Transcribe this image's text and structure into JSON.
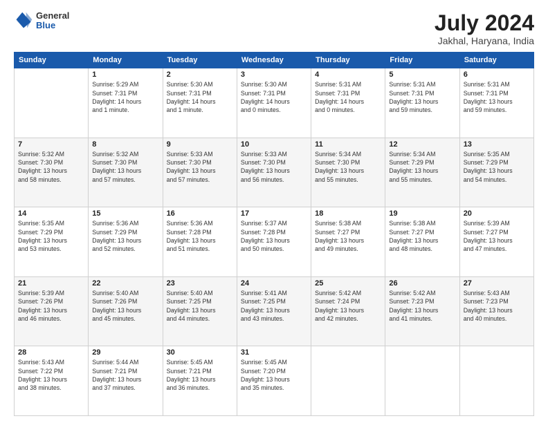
{
  "logo": {
    "general": "General",
    "blue": "Blue"
  },
  "title": "July 2024",
  "subtitle": "Jakhal, Haryana, India",
  "columns": [
    "Sunday",
    "Monday",
    "Tuesday",
    "Wednesday",
    "Thursday",
    "Friday",
    "Saturday"
  ],
  "weeks": [
    [
      {
        "day": "",
        "info": ""
      },
      {
        "day": "1",
        "info": "Sunrise: 5:29 AM\nSunset: 7:31 PM\nDaylight: 14 hours\nand 1 minute."
      },
      {
        "day": "2",
        "info": "Sunrise: 5:30 AM\nSunset: 7:31 PM\nDaylight: 14 hours\nand 1 minute."
      },
      {
        "day": "3",
        "info": "Sunrise: 5:30 AM\nSunset: 7:31 PM\nDaylight: 14 hours\nand 0 minutes."
      },
      {
        "day": "4",
        "info": "Sunrise: 5:31 AM\nSunset: 7:31 PM\nDaylight: 14 hours\nand 0 minutes."
      },
      {
        "day": "5",
        "info": "Sunrise: 5:31 AM\nSunset: 7:31 PM\nDaylight: 13 hours\nand 59 minutes."
      },
      {
        "day": "6",
        "info": "Sunrise: 5:31 AM\nSunset: 7:31 PM\nDaylight: 13 hours\nand 59 minutes."
      }
    ],
    [
      {
        "day": "7",
        "info": "Sunrise: 5:32 AM\nSunset: 7:30 PM\nDaylight: 13 hours\nand 58 minutes."
      },
      {
        "day": "8",
        "info": "Sunrise: 5:32 AM\nSunset: 7:30 PM\nDaylight: 13 hours\nand 57 minutes."
      },
      {
        "day": "9",
        "info": "Sunrise: 5:33 AM\nSunset: 7:30 PM\nDaylight: 13 hours\nand 57 minutes."
      },
      {
        "day": "10",
        "info": "Sunrise: 5:33 AM\nSunset: 7:30 PM\nDaylight: 13 hours\nand 56 minutes."
      },
      {
        "day": "11",
        "info": "Sunrise: 5:34 AM\nSunset: 7:30 PM\nDaylight: 13 hours\nand 55 minutes."
      },
      {
        "day": "12",
        "info": "Sunrise: 5:34 AM\nSunset: 7:29 PM\nDaylight: 13 hours\nand 55 minutes."
      },
      {
        "day": "13",
        "info": "Sunrise: 5:35 AM\nSunset: 7:29 PM\nDaylight: 13 hours\nand 54 minutes."
      }
    ],
    [
      {
        "day": "14",
        "info": "Sunrise: 5:35 AM\nSunset: 7:29 PM\nDaylight: 13 hours\nand 53 minutes."
      },
      {
        "day": "15",
        "info": "Sunrise: 5:36 AM\nSunset: 7:29 PM\nDaylight: 13 hours\nand 52 minutes."
      },
      {
        "day": "16",
        "info": "Sunrise: 5:36 AM\nSunset: 7:28 PM\nDaylight: 13 hours\nand 51 minutes."
      },
      {
        "day": "17",
        "info": "Sunrise: 5:37 AM\nSunset: 7:28 PM\nDaylight: 13 hours\nand 50 minutes."
      },
      {
        "day": "18",
        "info": "Sunrise: 5:38 AM\nSunset: 7:27 PM\nDaylight: 13 hours\nand 49 minutes."
      },
      {
        "day": "19",
        "info": "Sunrise: 5:38 AM\nSunset: 7:27 PM\nDaylight: 13 hours\nand 48 minutes."
      },
      {
        "day": "20",
        "info": "Sunrise: 5:39 AM\nSunset: 7:27 PM\nDaylight: 13 hours\nand 47 minutes."
      }
    ],
    [
      {
        "day": "21",
        "info": "Sunrise: 5:39 AM\nSunset: 7:26 PM\nDaylight: 13 hours\nand 46 minutes."
      },
      {
        "day": "22",
        "info": "Sunrise: 5:40 AM\nSunset: 7:26 PM\nDaylight: 13 hours\nand 45 minutes."
      },
      {
        "day": "23",
        "info": "Sunrise: 5:40 AM\nSunset: 7:25 PM\nDaylight: 13 hours\nand 44 minutes."
      },
      {
        "day": "24",
        "info": "Sunrise: 5:41 AM\nSunset: 7:25 PM\nDaylight: 13 hours\nand 43 minutes."
      },
      {
        "day": "25",
        "info": "Sunrise: 5:42 AM\nSunset: 7:24 PM\nDaylight: 13 hours\nand 42 minutes."
      },
      {
        "day": "26",
        "info": "Sunrise: 5:42 AM\nSunset: 7:23 PM\nDaylight: 13 hours\nand 41 minutes."
      },
      {
        "day": "27",
        "info": "Sunrise: 5:43 AM\nSunset: 7:23 PM\nDaylight: 13 hours\nand 40 minutes."
      }
    ],
    [
      {
        "day": "28",
        "info": "Sunrise: 5:43 AM\nSunset: 7:22 PM\nDaylight: 13 hours\nand 38 minutes."
      },
      {
        "day": "29",
        "info": "Sunrise: 5:44 AM\nSunset: 7:21 PM\nDaylight: 13 hours\nand 37 minutes."
      },
      {
        "day": "30",
        "info": "Sunrise: 5:45 AM\nSunset: 7:21 PM\nDaylight: 13 hours\nand 36 minutes."
      },
      {
        "day": "31",
        "info": "Sunrise: 5:45 AM\nSunset: 7:20 PM\nDaylight: 13 hours\nand 35 minutes."
      },
      {
        "day": "",
        "info": ""
      },
      {
        "day": "",
        "info": ""
      },
      {
        "day": "",
        "info": ""
      }
    ]
  ]
}
